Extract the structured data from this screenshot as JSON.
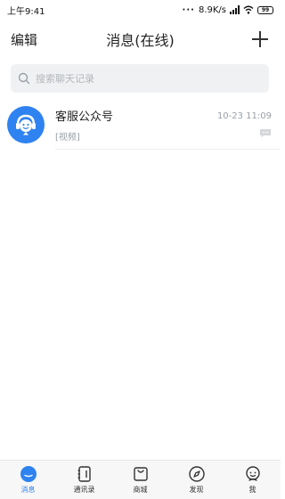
{
  "status_bar": {
    "time": "上午9:41",
    "network_speed": "8.9K/s",
    "battery": "99"
  },
  "nav": {
    "edit_label": "编辑",
    "title": "消息(在线)"
  },
  "search": {
    "placeholder": "搜索聊天记录"
  },
  "conversations": [
    {
      "name": "客服公众号",
      "preview": "[视频]",
      "time": "10-23 11:09"
    }
  ],
  "tabs": [
    {
      "label": "消息",
      "active": true
    },
    {
      "label": "通讯录",
      "active": false
    },
    {
      "label": "商城",
      "active": false
    },
    {
      "label": "发现",
      "active": false
    },
    {
      "label": "我",
      "active": false
    }
  ],
  "colors": {
    "accent": "#2f83f0",
    "search_bg": "#f0f1f3",
    "muted_text": "#9aa0a6"
  }
}
